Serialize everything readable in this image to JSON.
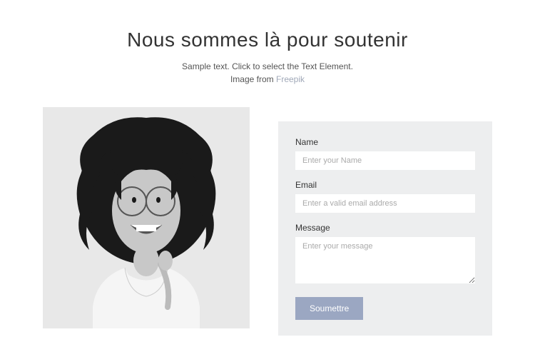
{
  "header": {
    "title": "Nous sommes là pour soutenir",
    "subtitle_line1": "Sample text. Click to select the Text Element.",
    "subtitle_line2_prefix": "Image from ",
    "subtitle_link": "Freepik"
  },
  "form": {
    "name_label": "Name",
    "name_placeholder": "Enter your Name",
    "email_label": "Email",
    "email_placeholder": "Enter a valid email address",
    "message_label": "Message",
    "message_placeholder": "Enter your message",
    "submit_label": "Soumettre"
  }
}
